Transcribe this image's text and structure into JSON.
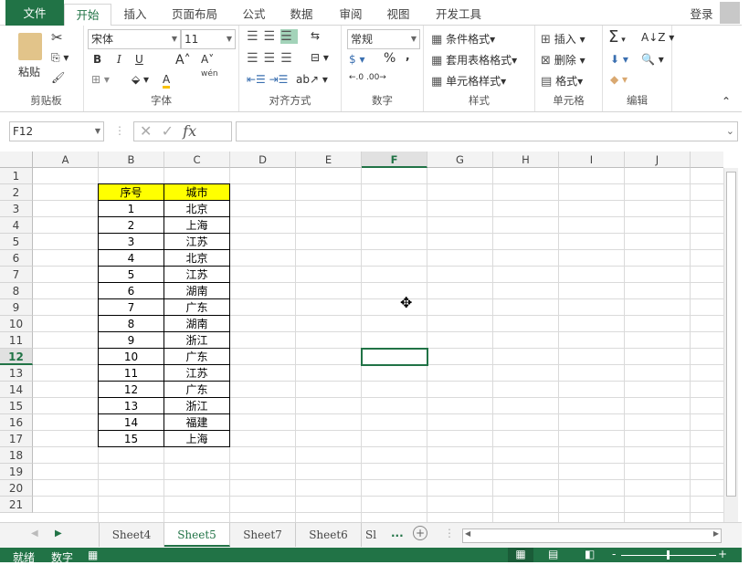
{
  "tabs": [
    "文件",
    "开始",
    "插入",
    "页面布局",
    "公式",
    "数据",
    "审阅",
    "视图",
    "开发工具"
  ],
  "login": "登录",
  "ribbon": {
    "clipboard": {
      "paste": "粘贴",
      "label": "剪贴板"
    },
    "font": {
      "name": "宋体",
      "size": "11",
      "label": "字体",
      "bold": "B",
      "italic": "I",
      "underline": "U",
      "wen": "wén"
    },
    "align": {
      "label": "对齐方式"
    },
    "number": {
      "format": "常规",
      "percent": "%",
      "comma": ",",
      "label": "数字"
    },
    "styles": {
      "cond": "条件格式",
      "table": "套用表格格式",
      "cell": "单元格样式",
      "label": "样式"
    },
    "cells": {
      "insert": "插入",
      "delete": "删除",
      "format": "格式",
      "label": "单元格"
    },
    "edit": {
      "sum": "Σ",
      "label": "编辑"
    }
  },
  "formula": {
    "namebox": "F12",
    "fx": "fx",
    "value": ""
  },
  "columns": [
    "A",
    "B",
    "C",
    "D",
    "E",
    "F",
    "G",
    "H",
    "I",
    "J"
  ],
  "selected_col": "F",
  "selected_row": 12,
  "rows": 21,
  "table": {
    "header": [
      "序号",
      "城市"
    ],
    "rows": [
      [
        "1",
        "北京"
      ],
      [
        "2",
        "上海"
      ],
      [
        "3",
        "江苏"
      ],
      [
        "4",
        "北京"
      ],
      [
        "5",
        "江苏"
      ],
      [
        "6",
        "湖南"
      ],
      [
        "7",
        "广东"
      ],
      [
        "8",
        "湖南"
      ],
      [
        "9",
        "浙江"
      ],
      [
        "10",
        "广东"
      ],
      [
        "11",
        "江苏"
      ],
      [
        "12",
        "广东"
      ],
      [
        "13",
        "浙江"
      ],
      [
        "14",
        "福建"
      ],
      [
        "15",
        "上海"
      ]
    ]
  },
  "sheets": [
    "Sheet4",
    "Sheet5",
    "Sheet7",
    "Sheet6",
    "Sl"
  ],
  "active_sheet": "Sheet5",
  "more": "...",
  "status": {
    "ready": "就绪",
    "mode": "数字"
  },
  "colors": {
    "accent": "#217346",
    "header_fill": "#ffff00"
  }
}
